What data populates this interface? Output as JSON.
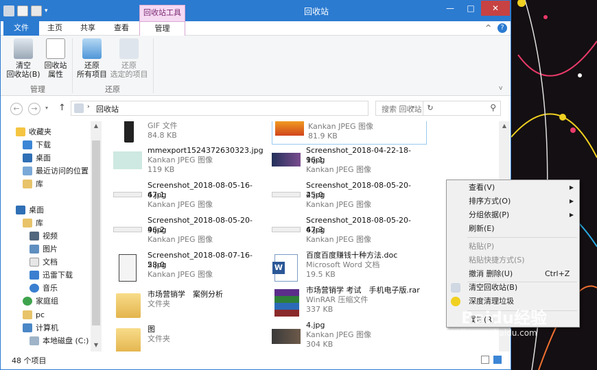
{
  "window": {
    "title": "回收站",
    "context_tab_group": "回收站工具",
    "controls": {
      "minimize": "—",
      "maximize": "□",
      "close": "✕"
    }
  },
  "ribbon_tabs": [
    {
      "label": "文件"
    },
    {
      "label": "主页"
    },
    {
      "label": "共享"
    },
    {
      "label": "查看"
    },
    {
      "label": "管理"
    }
  ],
  "ribbon": {
    "empty_bin": "清空\n回收站(B)",
    "empty_bin_l1": "清空",
    "empty_bin_l2": "回收站(B)",
    "bin_props_l1": "回收站",
    "bin_props_l2": "属性",
    "group_manage": "管理",
    "restore_all_l1": "还原",
    "restore_all_l2": "所有项目",
    "restore_sel_l1": "还原",
    "restore_sel_l2": "选定的项目",
    "group_restore": "还原"
  },
  "address": {
    "crumb": "回收站",
    "search_placeholder": "搜索 回收站"
  },
  "nav": {
    "items": [
      {
        "label": "收藏夹"
      },
      {
        "label": "下载"
      },
      {
        "label": "桌面"
      },
      {
        "label": "最近访问的位置"
      },
      {
        "label": "库"
      },
      {
        "label": "桌面"
      },
      {
        "label": "库"
      },
      {
        "label": "视频"
      },
      {
        "label": "图片"
      },
      {
        "label": "文档"
      },
      {
        "label": "迅雷下载"
      },
      {
        "label": "音乐"
      },
      {
        "label": "家庭组"
      },
      {
        "label": "pc"
      },
      {
        "label": "计算机"
      },
      {
        "label": "本地磁盘 (C:)"
      }
    ]
  },
  "files": [
    {
      "name": "",
      "type": "GIF 文件",
      "size": "84.8 KB"
    },
    {
      "name": "",
      "type": "Kankan JPEG 图像",
      "size": "81.9 KB"
    },
    {
      "name": "mmexport1524372630323.jpg",
      "type": "Kankan JPEG 图像",
      "size": "119 KB"
    },
    {
      "name": "Screenshot_2018-04-22-18-16-19.jpg",
      "name_l1": "Screenshot_2018-04-22-18-16-1",
      "name_l2": "9.jpg",
      "type": "Kankan JPEG 图像",
      "size": ""
    },
    {
      "name_l1": "Screenshot_2018-08-05-16-47-1",
      "name_l2": "6.jpg",
      "type": "Kankan JPEG 图像"
    },
    {
      "name_l1": "Screenshot_2018-08-05-20-45-0",
      "name_l2": "2.jpg",
      "type": "Kankan JPEG 图像"
    },
    {
      "name_l1": "Screenshot_2018-08-05-20-46-2",
      "name_l2": "9.jpg",
      "type": "Kankan JPEG 图像"
    },
    {
      "name_l1": "Screenshot_2018-08-05-20-47-3",
      "name_l2": "6.jpg",
      "type": "Kankan JPEG 图像"
    },
    {
      "name_l1": "Screenshot_2018-08-07-16-58-0",
      "name_l2": "2.jpg",
      "type": "Kankan JPEG 图像"
    },
    {
      "name": "百度百度赚钱十种方法.doc",
      "type": "Microsoft Word 文档",
      "size": "19.5 KB"
    },
    {
      "name": "市场营销学　案例分析",
      "type": "文件夹"
    },
    {
      "name": "市场营销学 考试　手机电子版.rar",
      "type": "WinRAR 压缩文件",
      "size": "337 KB"
    },
    {
      "name": "图",
      "type": "文件夹"
    },
    {
      "name": "4.jpg",
      "type": "Kankan JPEG 图像",
      "size": "304 KB"
    }
  ],
  "status": {
    "count": "48 个项目"
  },
  "context_menu": {
    "items": [
      {
        "label": "查看(V)"
      },
      {
        "label": "排序方式(O)"
      },
      {
        "label": "分组依据(P)"
      },
      {
        "label": "刷新(E)"
      },
      {
        "label": "粘贴(P)"
      },
      {
        "label": "粘贴快捷方式(S)"
      },
      {
        "label": "撤消 删除(U)",
        "shortcut": "Ctrl+Z"
      },
      {
        "label": "清空回收站(B)"
      },
      {
        "label": "深度清理垃圾"
      },
      {
        "label": "属性(R)"
      }
    ]
  },
  "watermark": {
    "brand": "Baidu经验",
    "url": "jingyan.baidu.com"
  },
  "colors": {
    "accent": "#2b7bd1",
    "context_tab": "#f6d9f3",
    "close": "#c74242"
  }
}
